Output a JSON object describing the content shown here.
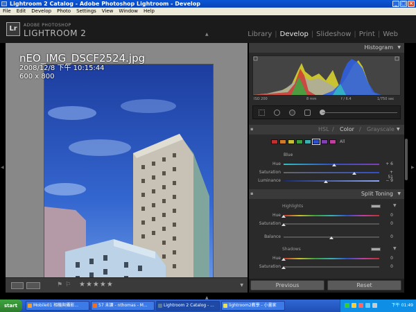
{
  "window": {
    "title": "Lightroom 2 Catalog - Adobe Photoshop Lightroom - Develop"
  },
  "menu": [
    "File",
    "Edit",
    "Develop",
    "Photo",
    "Settings",
    "View",
    "Window",
    "Help"
  ],
  "brand": {
    "logo": "Lr",
    "small": "ADOBE PHOTOSHOP",
    "big": "LIGHTROOM 2"
  },
  "modules": {
    "items": [
      "Library",
      "Develop",
      "Slideshow",
      "Print",
      "Web"
    ],
    "active": "Develop"
  },
  "photo": {
    "filename": "nEO_IMG_DSCF2524.jpg",
    "datetime": "2008/12/8 下午 10:15:44",
    "dimensions": "600 x 800"
  },
  "histogram": {
    "title": "Histogram",
    "iso": "ISO 200",
    "focal": "8 mm",
    "aperture": "f / 6.4",
    "shutter": "1/750 sec"
  },
  "hsl": {
    "tab_hsl": "HSL",
    "tab_sep1": "/",
    "tab_color": "Color",
    "tab_sep2": "/",
    "tab_grayscale": "Grayscale",
    "all_label": "All",
    "selected_color": "Blue",
    "swatch_colors": [
      "#c03030",
      "#d07a2a",
      "#c8c030",
      "#3aa040",
      "#3ab0b0",
      "#3050c8",
      "#8040b0",
      "#c040a0"
    ],
    "controls": [
      {
        "label": "Hue",
        "value": "+ 6",
        "fraction": 0.56
      },
      {
        "label": "Saturation",
        "value": "+ 51",
        "fraction": 0.75
      },
      {
        "label": "Luminance",
        "value": "− 9",
        "fraction": 0.46
      }
    ]
  },
  "split_toning": {
    "title": "Split Toning",
    "highlights": "Highlights",
    "hi_hue": {
      "label": "Hue",
      "value": "0"
    },
    "hi_sat": {
      "label": "Saturation",
      "value": "0"
    },
    "balance": {
      "label": "Balance",
      "value": "0"
    },
    "shadows": "Shadows",
    "sh_hue": {
      "label": "Hue",
      "value": "0"
    },
    "sh_sat": {
      "label": "Saturation",
      "value": "0"
    }
  },
  "buttons": {
    "previous": "Previous",
    "reset": "Reset"
  },
  "taskbar": {
    "start": "start",
    "tasks": [
      "Mobile01 相機與攝影...",
      "57 未讀 - nthomas - M...",
      "Lightroom 2 Catalog - ...",
      "lightroom2教學 - 小畫家"
    ],
    "clock": "下午 01:49"
  }
}
